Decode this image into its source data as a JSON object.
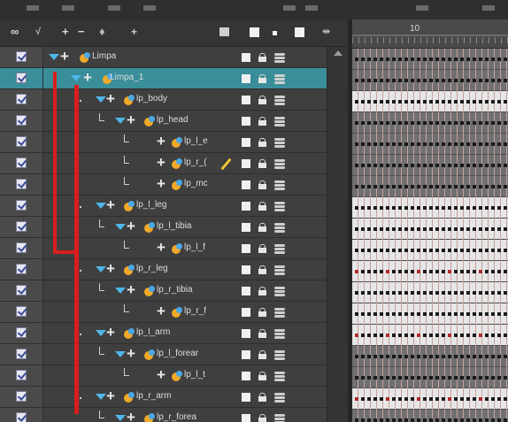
{
  "toolbar": {
    "onion_label": "∞",
    "plus_label": "+",
    "minus_label": "−",
    "split_label": "⇹"
  },
  "timeline": {
    "frame_label": "10"
  },
  "layers": [
    {
      "name": "Limpa"
    },
    {
      "name": "Limpa_1"
    },
    {
      "name": "lp_body"
    },
    {
      "name": "lp_head"
    },
    {
      "name": "lp_l_e"
    },
    {
      "name": "lp_r_("
    },
    {
      "name": "lp_mc"
    },
    {
      "name": "lp_l_leg"
    },
    {
      "name": "lp_l_tibia"
    },
    {
      "name": "lp_l_f"
    },
    {
      "name": "lp_r_leg"
    },
    {
      "name": "lp_r_tibia"
    },
    {
      "name": "lp_r_f"
    },
    {
      "name": "lp_l_arm"
    },
    {
      "name": "lp_l_forear"
    },
    {
      "name": "lp_l_t"
    },
    {
      "name": "lp_r_arm"
    },
    {
      "name": "lp_r_forea"
    }
  ],
  "colors": {
    "selected_row": "#3a8e9a",
    "rig_line": "#d81e1e",
    "peg_orange": "#f2a92a",
    "peg_blue": "#4aa8e6",
    "expand_arrow": "#4fb6e8"
  }
}
